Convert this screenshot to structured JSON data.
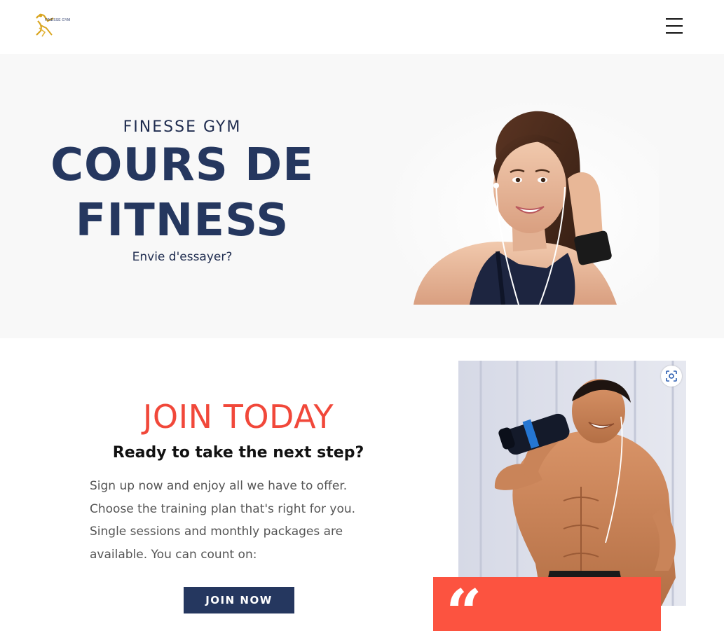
{
  "header": {
    "logo_icon": "finesse-gym-logo",
    "logo_text": "FINESSE GYM",
    "menu_icon": "hamburger-menu-icon"
  },
  "hero": {
    "eyebrow": "FINESSE GYM",
    "title": "COURS DE FITNESS",
    "subtitle": "Envie d'essayer?",
    "image": "woman-with-earphones-photo"
  },
  "join": {
    "title": "JOIN TODAY",
    "subtitle": "Ready to take the next step?",
    "text": "Sign up now and enjoy all we have to offer. Choose the training plan that's right for you. Single sessions and monthly packages are available. You can count on:",
    "button_label": "JOIN NOW",
    "image": "man-drinking-shaker-photo",
    "lens_icon": "visual-search-icon",
    "quote_icon": "quote-mark-icon",
    "quote_mark": "“"
  },
  "colors": {
    "navy": "#25375f",
    "accent_red": "#fc5340",
    "join_title": "#f1483a",
    "hero_bg": "#f8f8f8"
  }
}
